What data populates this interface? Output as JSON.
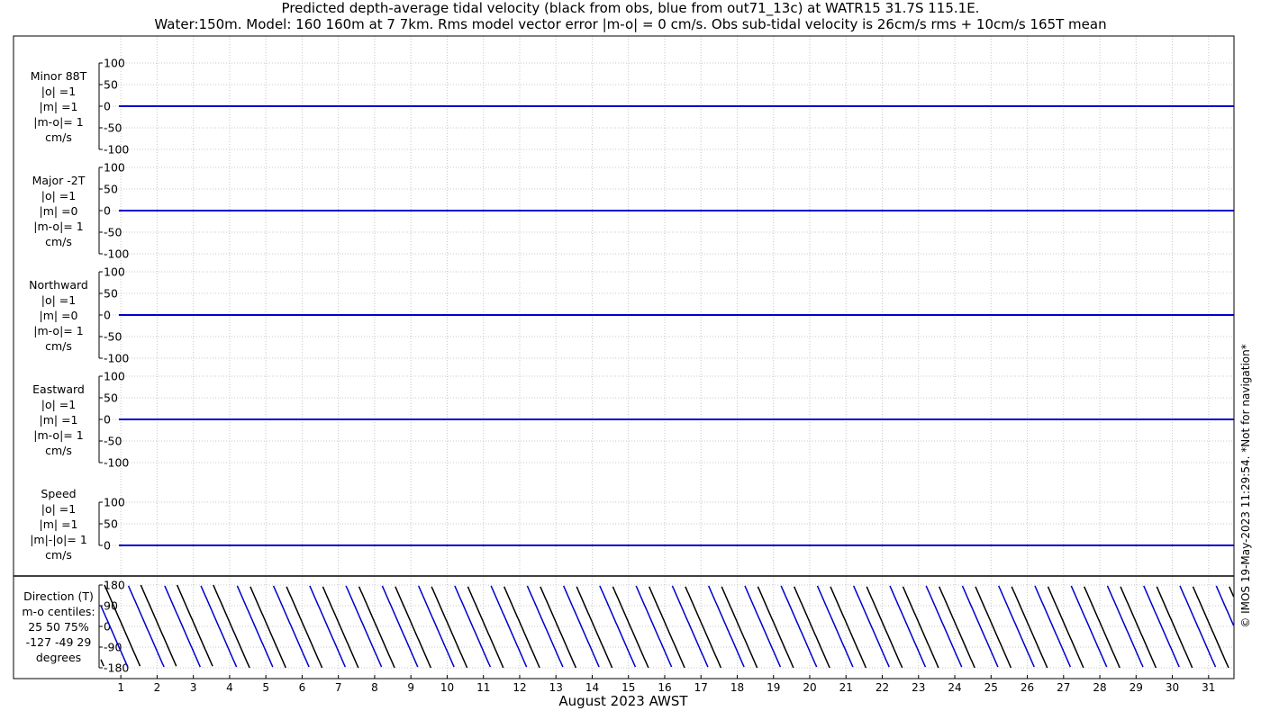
{
  "title_line1": "Predicted depth-average tidal velocity (black from obs, blue from out71_13c) at WATR15 31.7S 115.1E.",
  "title_line2": "Water:150m. Model: 160 160m at 7 7km. Rms model vector error |m-o| = 0 cm/s. Obs sub-tidal velocity is 26cm/s rms + 10cm/s 165T mean",
  "xlabel": "August 2023 AWST",
  "side_note": "© IMOS 19-May-2023 11:29:54. *Not for navigation*",
  "colors": {
    "obs": "#000000",
    "model": "#0000cc",
    "grid": "#c8c8c8"
  },
  "chart_data": [
    {
      "type": "line",
      "name": "minor",
      "label_lines": [
        "Minor 88T",
        "|o| =1",
        "|m| =1",
        "|m-o|= 1",
        "cm/s"
      ],
      "yticks": [
        "100",
        "50",
        "0",
        "-50",
        "-100"
      ],
      "ylim": [
        -100,
        100
      ],
      "xlim": [
        0.4,
        31.7
      ],
      "series": [
        {
          "name": "obs",
          "constant": 0
        },
        {
          "name": "model",
          "constant": 0
        }
      ]
    },
    {
      "type": "line",
      "name": "major",
      "label_lines": [
        "Major -2T",
        "|o| =1",
        "|m| =0",
        "|m-o|= 1",
        "cm/s"
      ],
      "yticks": [
        "100",
        "50",
        "0",
        "-50",
        "-100"
      ],
      "ylim": [
        -100,
        100
      ],
      "xlim": [
        0.4,
        31.7
      ],
      "series": [
        {
          "name": "obs",
          "constant": 0
        },
        {
          "name": "model",
          "constant": 0
        }
      ]
    },
    {
      "type": "line",
      "name": "northward",
      "label_lines": [
        "Northward",
        "|o| =1",
        "|m| =0",
        "|m-o|= 1",
        "cm/s"
      ],
      "yticks": [
        "100",
        "50",
        "0",
        "-50",
        "-100"
      ],
      "ylim": [
        -100,
        100
      ],
      "xlim": [
        0.4,
        31.7
      ],
      "series": [
        {
          "name": "obs",
          "constant": 0
        },
        {
          "name": "model",
          "constant": 0
        }
      ]
    },
    {
      "type": "line",
      "name": "eastward",
      "label_lines": [
        "Eastward",
        "|o| =1",
        "|m| =1",
        "|m-o|= 1",
        "cm/s"
      ],
      "yticks": [
        "100",
        "50",
        "0",
        "-50",
        "-100"
      ],
      "ylim": [
        -100,
        100
      ],
      "xlim": [
        0.4,
        31.7
      ],
      "series": [
        {
          "name": "obs",
          "constant": 0
        },
        {
          "name": "model",
          "constant": 0
        }
      ]
    },
    {
      "type": "line",
      "name": "speed",
      "label_lines": [
        "Speed",
        "|o| =1",
        "|m| =1",
        "|m|-|o|= 1",
        "cm/s"
      ],
      "yticks": [
        "100",
        "50",
        "0"
      ],
      "ylim": [
        0,
        100
      ],
      "xlim": [
        0.4,
        31.7
      ],
      "series": [
        {
          "name": "obs",
          "constant": 0
        },
        {
          "name": "model",
          "constant": 0
        }
      ]
    },
    {
      "type": "line",
      "name": "direction",
      "label_lines": [
        "Direction (T)",
        "m-o centiles:",
        " 25  50  75%",
        "-127  -49   29",
        "degrees"
      ],
      "yticks": [
        "180",
        "90",
        "0",
        "-90",
        "-180"
      ],
      "ylim": [
        -180,
        180
      ],
      "xlim": [
        0.4,
        31.7
      ],
      "xticks": [
        "1",
        "2",
        "3",
        "4",
        "5",
        "6",
        "7",
        "8",
        "9",
        "10",
        "11",
        "12",
        "13",
        "14",
        "15",
        "16",
        "17",
        "18",
        "19",
        "20",
        "21",
        "22",
        "23",
        "24",
        "25",
        "26",
        "27",
        "28",
        "29",
        "30",
        "31"
      ],
      "series": [
        {
          "name": "obs",
          "period_days": 1.0,
          "phase_days": 0.55
        },
        {
          "name": "model",
          "period_days": 1.0,
          "phase_days": 0.2
        }
      ]
    }
  ]
}
